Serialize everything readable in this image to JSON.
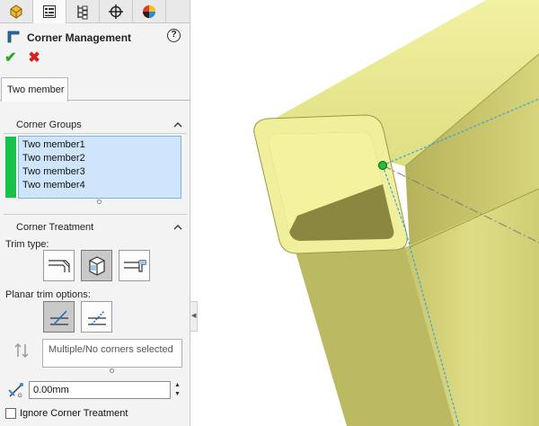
{
  "tabs": [
    {
      "icon": "feature-manager-icon"
    },
    {
      "icon": "property-manager-icon"
    },
    {
      "icon": "configuration-manager-icon"
    },
    {
      "icon": "dimxpert-icon"
    },
    {
      "icon": "display-manager-icon"
    }
  ],
  "header": {
    "title": "Corner Management",
    "help_label": "?"
  },
  "actions": {
    "ok": "✔",
    "cancel": "✖"
  },
  "corner_tab": {
    "label": "Two member"
  },
  "corner_groups": {
    "title": "Corner Groups",
    "items": [
      "Two member1",
      "Two member2",
      "Two member3",
      "Two member4"
    ],
    "highlight_color": "#18c24a"
  },
  "corner_treatment": {
    "title": "Corner Treatment",
    "trim_type_label": "Trim type:",
    "planar_label": "Planar trim options:",
    "selection_placeholder": "Multiple/No corners selected",
    "gap_value": "0.00mm",
    "ignore_label": "Ignore Corner Treatment"
  },
  "colors": {
    "model_fill": "#e8e88f",
    "model_shadow": "#8d8b3e",
    "selection_blue": "#cfe5fb",
    "sketch_line": "#3ba3e0"
  }
}
